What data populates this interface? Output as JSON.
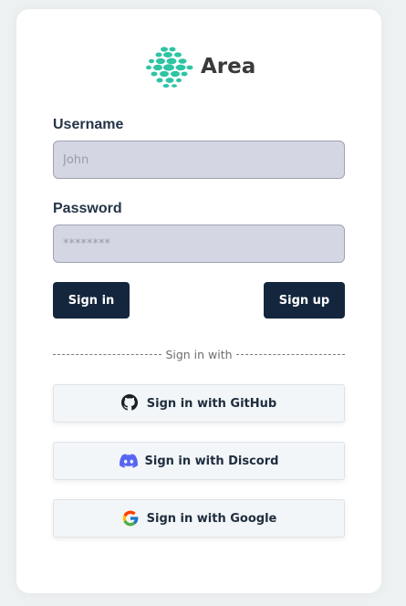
{
  "brand": {
    "name": "Area",
    "logo_icon": "dotted-logo-icon",
    "logo_color": "#2ec4a4"
  },
  "form": {
    "username_label": "Username",
    "username_placeholder": "John",
    "username_value": "",
    "password_label": "Password",
    "password_placeholder": "********",
    "password_value": ""
  },
  "actions": {
    "sign_in_label": "Sign in",
    "sign_up_label": "Sign up",
    "button_color": "#13263d"
  },
  "divider": {
    "text": "Sign in with"
  },
  "oauth": [
    {
      "provider": "github",
      "label": "Sign in with GitHub",
      "icon": "github-icon"
    },
    {
      "provider": "discord",
      "label": "Sign in with Discord",
      "icon": "discord-icon",
      "icon_color": "#5865f2"
    },
    {
      "provider": "google",
      "label": "Sign in with Google",
      "icon": "google-icon"
    }
  ]
}
